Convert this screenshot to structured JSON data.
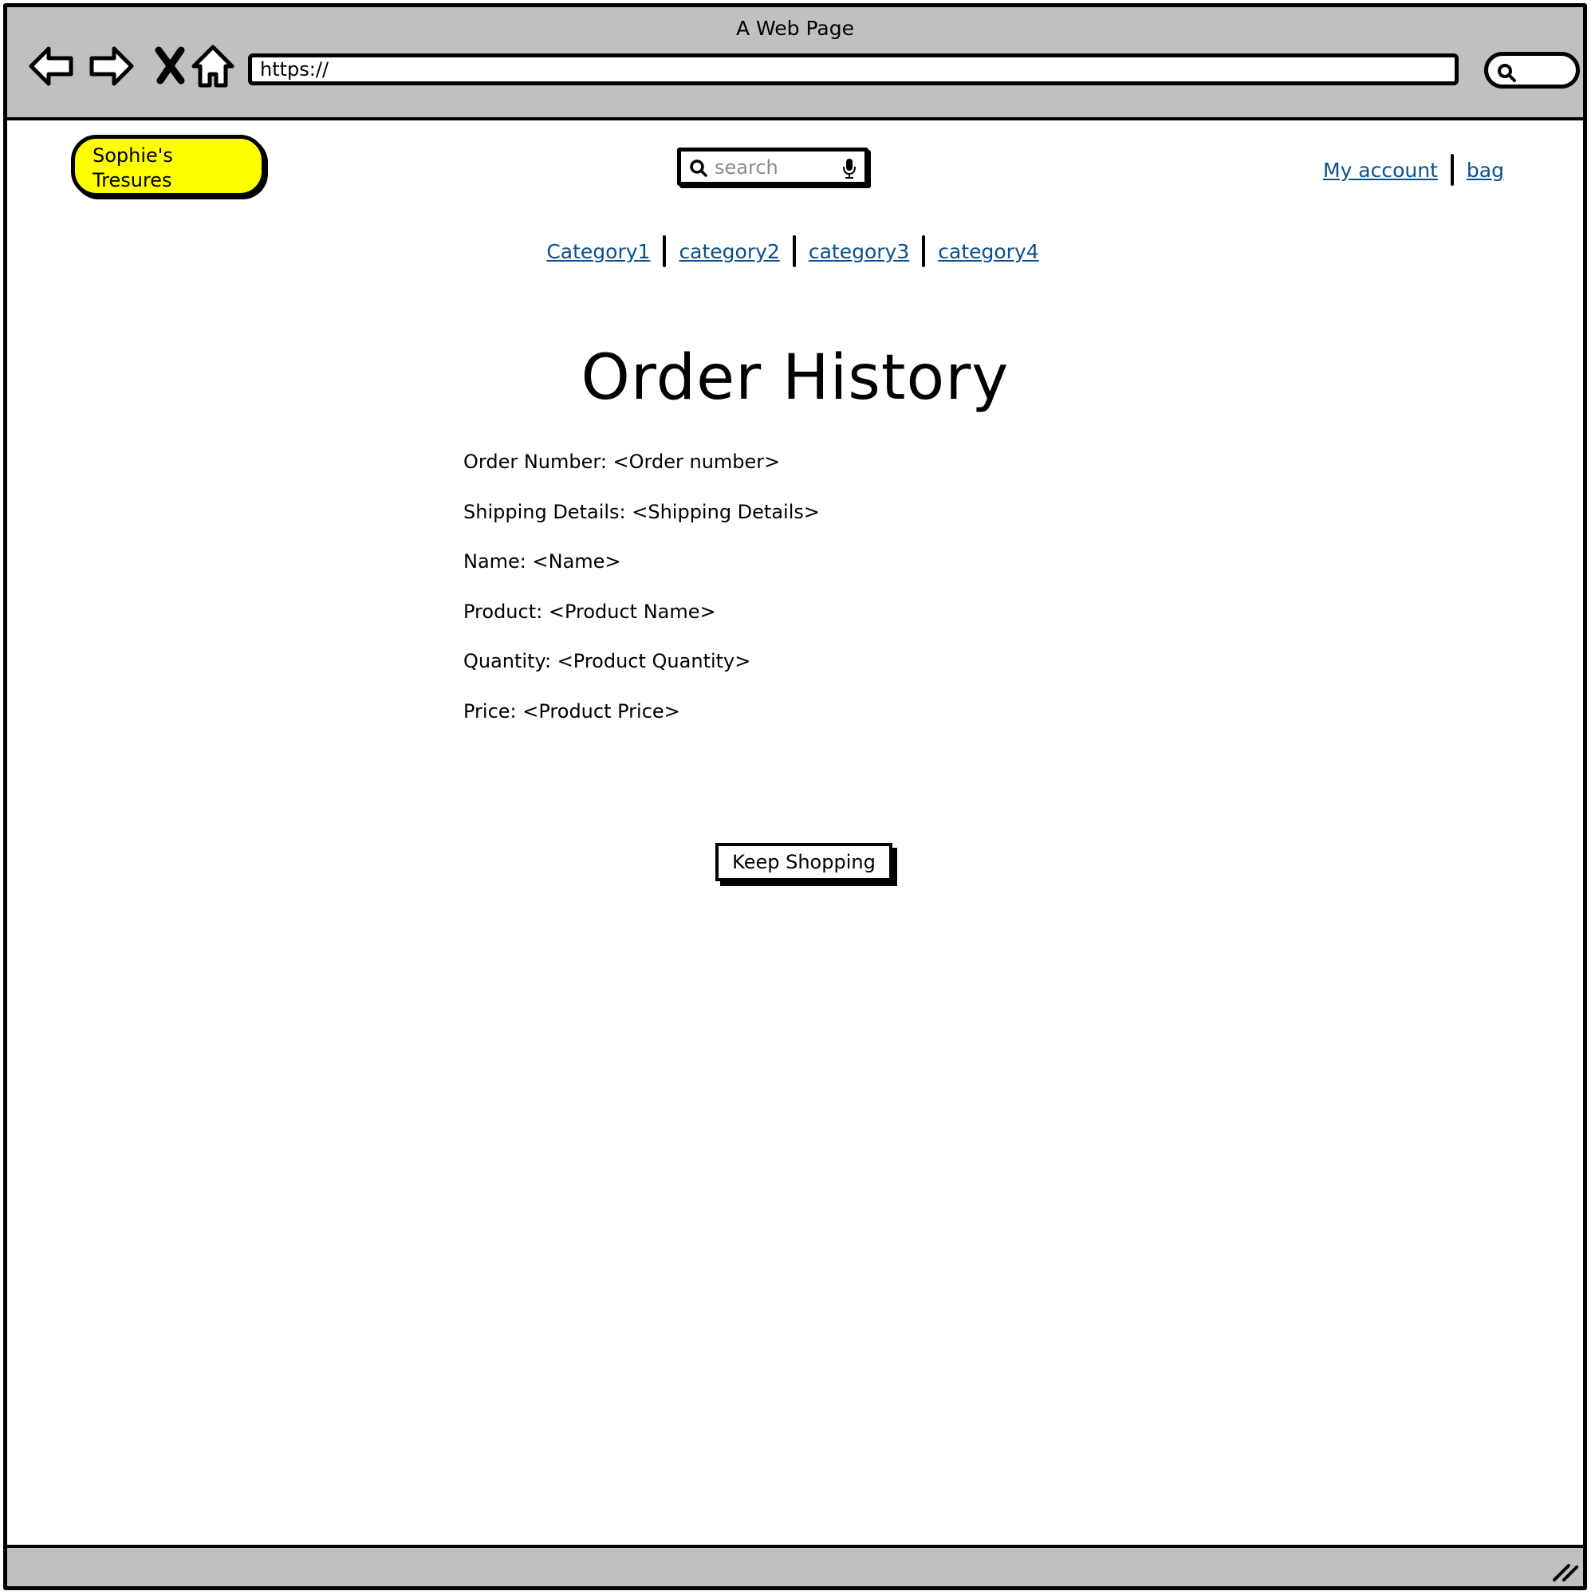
{
  "browser": {
    "window_title": "A Web Page",
    "url": "https://",
    "buttons": [
      "back",
      "forward",
      "stop",
      "home"
    ]
  },
  "header": {
    "logo_text": "Sophie's Tresures",
    "logo_color": "#ffff00",
    "search_placeholder": "search",
    "links": {
      "account": "My account",
      "bag": "bag"
    }
  },
  "categories": [
    "Category1",
    "category2",
    "category3",
    "category4"
  ],
  "link_color": "#0b4f8a",
  "main": {
    "title": "Order History",
    "details": [
      "Order Number: <Order number>",
      "Shipping Details: <Shipping Details>",
      "Name: <Name>",
      "Product: <Product Name>",
      "Quantity: <Product Quantity>",
      "Price: <Product Price>"
    ],
    "button_label": "Keep Shopping"
  }
}
